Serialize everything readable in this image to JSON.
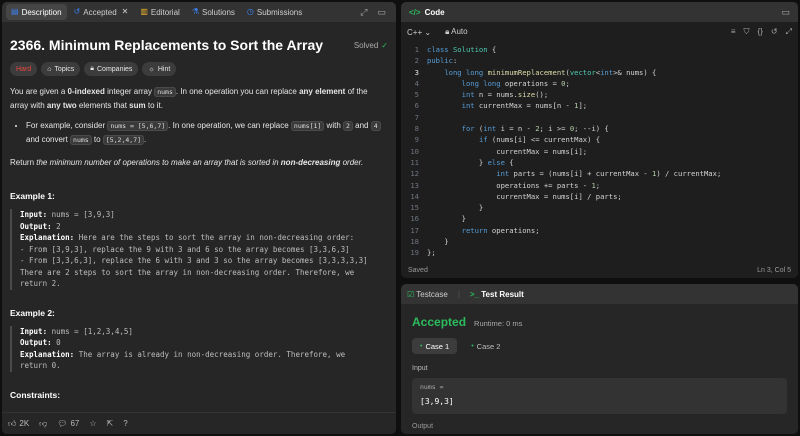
{
  "left": {
    "tabs": [
      {
        "label": "Description",
        "icon": "doc-icon"
      },
      {
        "label": "Accepted",
        "icon": "history-icon"
      },
      {
        "label": "Editorial",
        "icon": "book-icon"
      },
      {
        "label": "Solutions",
        "icon": "flask-icon"
      },
      {
        "label": "Submissions",
        "icon": "clock-icon"
      }
    ],
    "title": "2366. Minimum Replacements to Sort the Array",
    "status": "Solved",
    "pills": {
      "difficulty": "Hard",
      "topics": "Topics",
      "companies": "Companies",
      "hint": "Hint"
    },
    "desc": {
      "p1_a": "You are given a ",
      "p1_b": "0-indexed",
      "p1_c": " integer array ",
      "p1_code": "nums",
      "p1_d": ". In one operation you can replace ",
      "p1_e": "any element",
      "p1_f": " of the array with ",
      "p1_g": "any two",
      "p1_h": " elements that ",
      "p1_i": "sum",
      "p1_j": " to it.",
      "b_a": "For example, consider ",
      "b_code1": "nums = [5,6,7]",
      "b_b": ". In one operation, we can replace ",
      "b_code2": "nums[1]",
      "b_c": " with ",
      "b_code3": "2",
      "b_d": " and ",
      "b_code4": "4",
      "b_e": " and convert ",
      "b_code5": "nums",
      "b_f": " to ",
      "b_code6": "[5,2,4,7]",
      "b_g": ".",
      "p2_a": "Return ",
      "p2_b": "the minimum number of operations to make an array that is sorted in ",
      "p2_c": "non-decreasing",
      "p2_d": " order."
    },
    "ex1": {
      "header": "Example 1:",
      "input_k": "Input:",
      "input_v": " nums = [3,9,3]",
      "output_k": "Output:",
      "output_v": " 2",
      "expl_k": "Explanation:",
      "expl_l1": " Here are the steps to sort the array in non-decreasing order:",
      "expl_l2": "- From [3,9,3], replace the 9 with 3 and 6 so the array becomes [3,3,6,3]",
      "expl_l3": "- From [3,3,6,3], replace the 6 with 3 and 3 so the array becomes [3,3,3,3,3]",
      "expl_l4": "There are 2 steps to sort the array in non-decreasing order. Therefore, we",
      "expl_l5": "return 2."
    },
    "ex2": {
      "header": "Example 2:",
      "input_k": "Input:",
      "input_v": " nums = [1,2,3,4,5]",
      "output_k": "Output:",
      "output_v": " 0",
      "expl_k": "Explanation:",
      "expl_l1": " The array is already in non-decreasing order. Therefore, we",
      "expl_l2": "return 0."
    },
    "constraints_cut": "Constraints:",
    "bottom": {
      "likes": "2K",
      "comments": "67"
    }
  },
  "code": {
    "title": "Code",
    "language": "C++",
    "mode": "Auto",
    "lines": [
      "class Solution {",
      "public:",
      "    long long minimumReplacement(vector<int>& nums) {",
      "        long long operations = 0;",
      "        int n = nums.size();",
      "        int currentMax = nums[n - 1];",
      "",
      "        for (int i = n - 2; i >= 0; --i) {",
      "            if (nums[i] <= currentMax) {",
      "                currentMax = nums[i];",
      "            } else {",
      "                int parts = (nums[i] + currentMax - 1) / currentMax;",
      "                operations += parts - 1;",
      "                currentMax = nums[i] / parts;",
      "            }",
      "        }",
      "        return operations;",
      "    }",
      "};"
    ],
    "current_line": 3,
    "footer_left": "Saved",
    "footer_right": "Ln 3, Col 5"
  },
  "result": {
    "tab1": "Testcase",
    "tab2": "Test Result",
    "verdict": "Accepted",
    "runtime": "Runtime: 0 ms",
    "cases": [
      "Case 1",
      "Case 2"
    ],
    "input_label": "Input",
    "param_name": "nums =",
    "param_value": "[3,9,3]",
    "output_label": "Output"
  },
  "colors": {
    "accent_green": "#2cbb5d",
    "hard_red": "#ef4743"
  }
}
